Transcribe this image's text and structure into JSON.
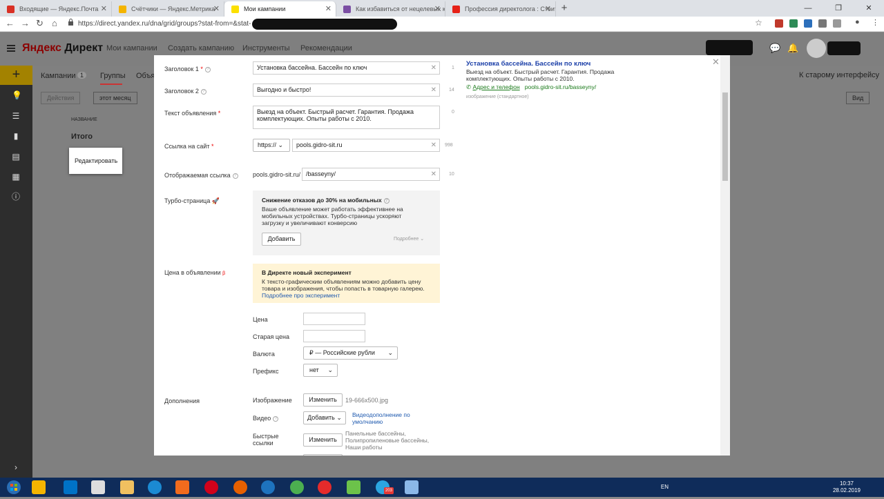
{
  "browser": {
    "tabs": [
      {
        "title": "Входящие — Яндекс.Почта",
        "color": "#d93025"
      },
      {
        "title": "Счётчики — Яндекс.Метрика",
        "color": "#f4b400"
      },
      {
        "title": "Мои кампании",
        "color": "#fce000"
      },
      {
        "title": "Как избавиться от нецелевых к",
        "color": "#7b4ea3"
      },
      {
        "title": "Профессия директолога : Стоит",
        "color": "#e62117"
      }
    ],
    "new_tab": "+",
    "window_controls": [
      "—",
      "❐",
      "✕"
    ],
    "url": "https://direct.yandex.ru/dna/grid/groups?stat-from=&stat-"
  },
  "header": {
    "logo_ya": "Яндекс",
    "logo_product": "Директ",
    "nav": [
      "Мои кампании",
      "Создать кампанию",
      "Инструменты",
      "Рекомендации"
    ]
  },
  "bg": {
    "breadcrumbs": [
      "Кампании",
      "1",
      "Группы",
      "Объя"
    ],
    "actions": "Действия",
    "period": "этот месяц",
    "column_name": "НАЗВАНИЕ",
    "total": "Итого",
    "old_ui": "К старому интерфейсу",
    "view": "Вид",
    "edit_popup": "Редактировать"
  },
  "form": {
    "title1_label": "Заголовок 1",
    "title1_value": "Установка бассейна. Бассейн по ключ",
    "title1_count": "1",
    "title2_label": "Заголовок 2",
    "title2_value": "Выгодно и быстро!",
    "title2_count": "14",
    "text_label": "Текст объявления",
    "text_value": "Выезд на объект. Быстрый расчет. Гарантия. Продажа комплектующих. Опыты работы с 2010.",
    "text_count": "0",
    "url_label": "Ссылка на сайт",
    "protocol": "https://",
    "url_value": "pools.gidro-sit.ru",
    "url_count": "998",
    "display_label": "Отображаемая ссылка",
    "display_prefix": "pools.gidro-sit.ru/",
    "display_value": "/basseyny/",
    "display_count": "10",
    "turbo_label": "Турбо-страница",
    "turbo_title": "Снижение отказов до 30% на мобильных",
    "turbo_text": "Ваше объявление может работать эффективнее на мобильных устройствах. Турбо-страницы ускоряют загрузку и увеличивают конверсию",
    "turbo_add": "Добавить",
    "turbo_more": "Подробнее",
    "price_label": "Цена в объявлении",
    "price_beta": "β",
    "exp_title": "В Директе новый эксперимент",
    "exp_text": "К тексто-графическим объявлениям можно добавить цену товара и изображения, чтобы попасть в товарную галерею.",
    "exp_link": "Подробнее про эксперимент",
    "price": "Цена",
    "old_price": "Старая цена",
    "currency_label": "Валюта",
    "currency_value": "₽ — Российские рубли",
    "prefix_label": "Префикс",
    "prefix_value": "нет",
    "extras_label": "Дополнения",
    "image_label": "Изображение",
    "image_btn": "Изменить",
    "image_file": "19-666x500.jpg",
    "video_label": "Видео",
    "video_btn": "Добавить",
    "video_link": "Видеодополнение по умолчанию",
    "quick_label": "Быстрые ссылки",
    "quick_btn": "Изменить",
    "quick_text": "Панельные бассейны, Полипропиленовые бассейны, Наши работы"
  },
  "preview": {
    "title": "Установка бассейна. Бассейн по ключ",
    "text": "Выезд на объект. Быстрый расчет. Гарантия. Продажа комплектующих. Опыты работы с 2010.",
    "contacts": "Адрес и телефон",
    "url": "pools.gidro-sit.ru/basseyny/",
    "image_note": "изображение (стандартное)"
  },
  "taskbar": {
    "lang": "EN",
    "time": "10:37",
    "date": "28.02.2019",
    "telegram_badge": "203"
  }
}
